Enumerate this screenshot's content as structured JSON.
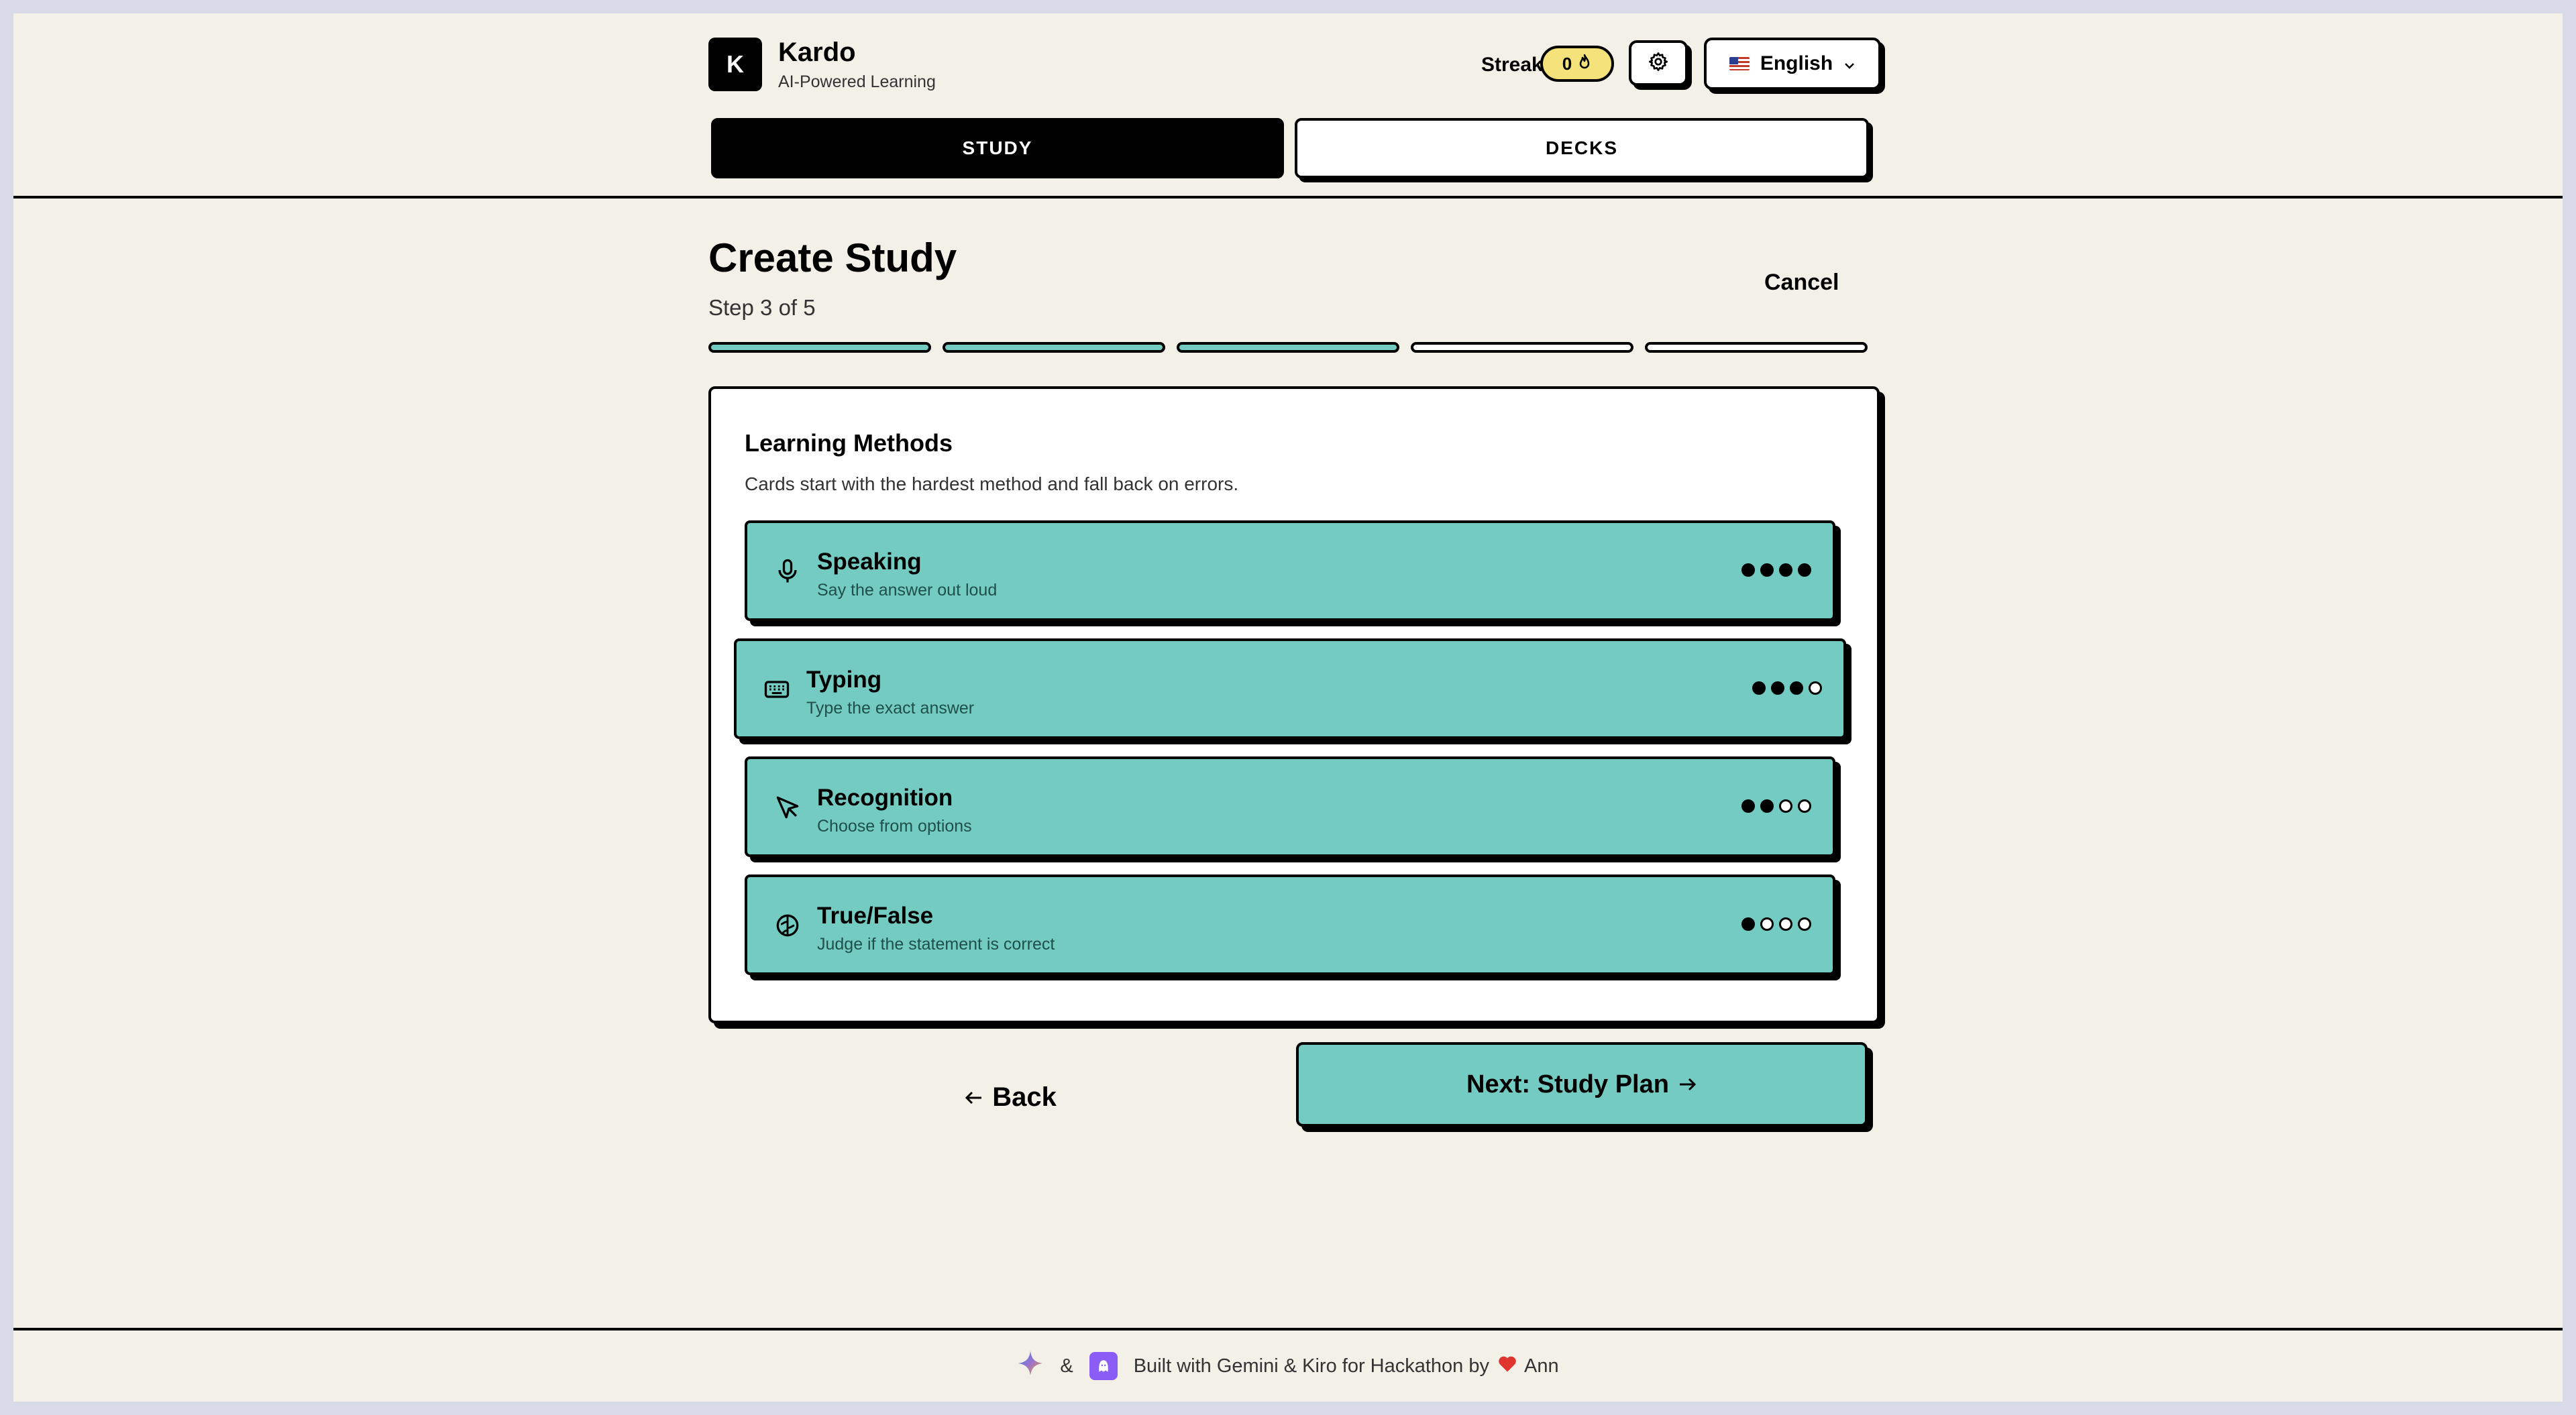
{
  "app": {
    "logo_letter": "K",
    "title": "Kardo",
    "subtitle": "AI-Powered Learning"
  },
  "header": {
    "streak_label": "Streak",
    "streak_count": "0",
    "language": "English",
    "tabs": [
      {
        "label": "STUDY",
        "active": true
      },
      {
        "label": "DECKS",
        "active": false
      }
    ]
  },
  "main": {
    "title": "Create Study",
    "step": "Step 3 of 5",
    "cancel_label": "Cancel",
    "progress": {
      "current": 3,
      "total": 5
    },
    "section_title": "Learning Methods",
    "section_desc": "Cards start with the hardest method and fall back on errors.",
    "methods": [
      {
        "label": "Speaking",
        "description": "Say the answer out loud",
        "difficulty": 4,
        "icon": "microphone-icon"
      },
      {
        "label": "Typing",
        "description": "Type the exact answer",
        "difficulty": 3,
        "icon": "keyboard-icon"
      },
      {
        "label": "Recognition",
        "description": "Choose from options",
        "difficulty": 2,
        "icon": "cursor-icon"
      },
      {
        "label": "True/False",
        "description": "Judge if the statement is correct",
        "difficulty": 1,
        "icon": "brain-icon"
      }
    ],
    "back_label": "Back",
    "next_label": "Next: Study Plan"
  },
  "footer": {
    "text": "Built with Gemini & Kiro for Hackathon by",
    "ampersand": "&",
    "author": "Ann"
  },
  "colors": {
    "accent": "#74cbc2",
    "background": "#f3f0e8",
    "streak": "#f5e27a",
    "kiro": "#8b5cf6"
  }
}
